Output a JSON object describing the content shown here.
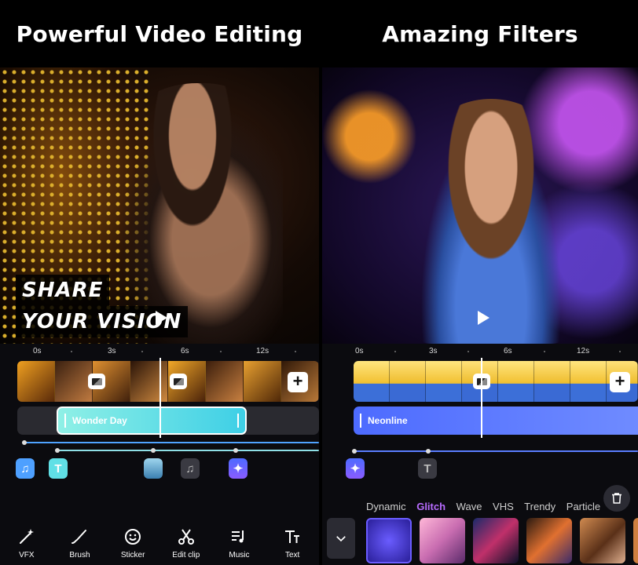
{
  "left_panel": {
    "headline": "Powerful Video Editing",
    "overlay_lines": [
      "SHARE",
      "YOUR VISION"
    ],
    "ruler": [
      "0s",
      "3s",
      "6s",
      "12s"
    ],
    "text_clip": "Wonder Day",
    "tools": [
      {
        "label": "VFX",
        "icon": "magic-wand-icon"
      },
      {
        "label": "Brush",
        "icon": "brush-icon"
      },
      {
        "label": "Sticker",
        "icon": "sticker-icon"
      },
      {
        "label": "Edit clip",
        "icon": "scissors-icon"
      },
      {
        "label": "Music",
        "icon": "music-list-icon"
      },
      {
        "label": "Text",
        "icon": "text-icon"
      }
    ],
    "mini_icons": [
      "music-note-icon",
      "text-icon",
      "image-icon",
      "music-note-icon",
      "magic-wand-icon"
    ]
  },
  "right_panel": {
    "headline": "Amazing Filters",
    "ruler": [
      "0s",
      "3s",
      "6s",
      "12s"
    ],
    "text_clip": "Neonline",
    "mini_icons": [
      "magic-wand-icon",
      "text-icon"
    ],
    "filter_categories": [
      "Dynamic",
      "Glitch",
      "Wave",
      "VHS",
      "Trendy",
      "Particle"
    ],
    "active_category": "Glitch"
  },
  "colors": {
    "cyan_clip": "#5fe3e6",
    "blue_clip": "#4d6bff",
    "accent_purple": "#b86cff"
  }
}
